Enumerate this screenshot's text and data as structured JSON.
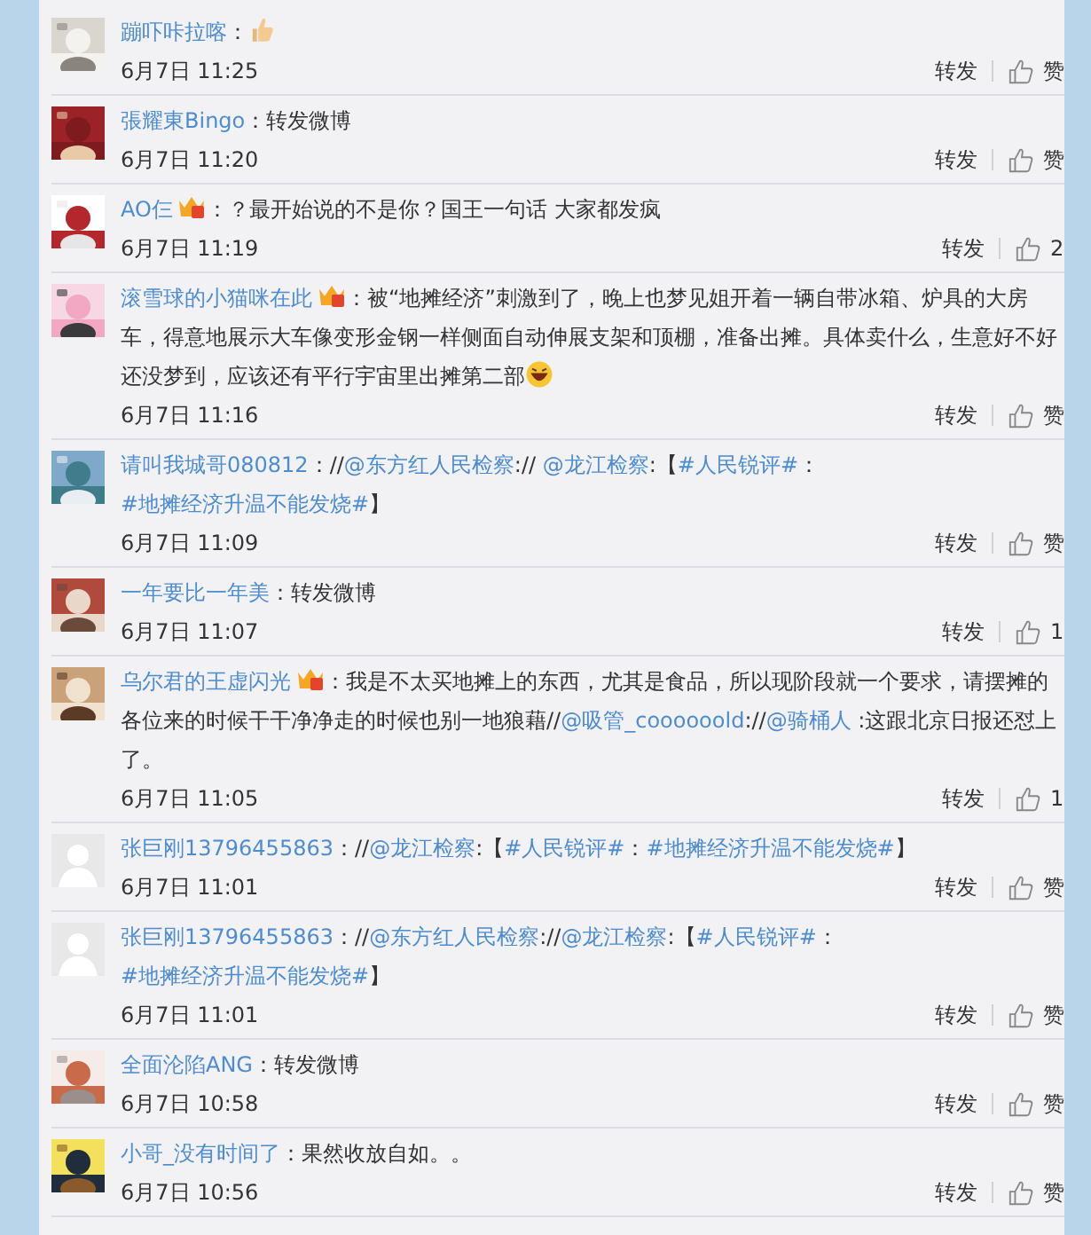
{
  "comments": [
    {
      "user": "蹦吓咔拉喀",
      "avatar": {
        "kind": "picture"
      },
      "badge": false,
      "content": [
        {
          "kind": "text",
          "text": "："
        },
        {
          "kind": "thumb-emoji"
        }
      ],
      "time": "6月7日 11:25",
      "repost": "转发",
      "likes": "赞"
    },
    {
      "user": "張耀東Bingo",
      "avatar": {
        "kind": "picture"
      },
      "badge": false,
      "content": [
        {
          "kind": "text",
          "text": "：转发微博"
        }
      ],
      "time": "6月7日 11:20",
      "repost": "转发",
      "likes": "赞"
    },
    {
      "user": "AO仨",
      "avatar": {
        "kind": "picture"
      },
      "badge": true,
      "content": [
        {
          "kind": "text",
          "text": "：？最开始说的不是你？国王一句话 大家都发疯"
        }
      ],
      "time": "6月7日 11:19",
      "repost": "转发",
      "likes": "2"
    },
    {
      "user": "滚雪球的小猫咪在此",
      "avatar": {
        "kind": "picture"
      },
      "badge": true,
      "content": [
        {
          "kind": "text",
          "text": "：被“地摊经济”刺激到了，晚上也梦见姐开着一辆自带冰箱、炉具的大房车，得意地展示大车像变形金钢一样侧面自动伸展支架和顶棚，准备出摊。具体卖什么，生意好不好还没梦到，应该还有平行宇宙里出摊第二部"
        },
        {
          "kind": "laugh-emoji"
        }
      ],
      "time": "6月7日 11:16",
      "repost": "转发",
      "likes": "赞"
    },
    {
      "user": "请叫我城哥080812",
      "avatar": {
        "kind": "picture"
      },
      "badge": false,
      "content": [
        {
          "kind": "text",
          "text": "：//"
        },
        {
          "kind": "link",
          "text": "@东方红人民检察"
        },
        {
          "kind": "text",
          "text": ":// "
        },
        {
          "kind": "link",
          "text": "@龙江检察"
        },
        {
          "kind": "text",
          "text": ":【"
        },
        {
          "kind": "link",
          "text": "#人民锐评#"
        },
        {
          "kind": "text",
          "text": "："
        },
        {
          "kind": "link",
          "text": "#地摊经济升温不能发烧#"
        },
        {
          "kind": "text",
          "text": "】"
        }
      ],
      "time": "6月7日 11:09",
      "repost": "转发",
      "likes": "赞"
    },
    {
      "user": "一年要比一年美",
      "avatar": {
        "kind": "picture"
      },
      "badge": false,
      "content": [
        {
          "kind": "text",
          "text": "：转发微博"
        }
      ],
      "time": "6月7日 11:07",
      "repost": "转发",
      "likes": "1"
    },
    {
      "user": "乌尔君的王虚闪光",
      "avatar": {
        "kind": "picture"
      },
      "badge": true,
      "content": [
        {
          "kind": "text",
          "text": "：我是不太买地摊上的东西，尤其是食品，所以现阶段就一个要求，请摆摊的各位来的时候干干净净走的时候也别一地狼藉//"
        },
        {
          "kind": "link",
          "text": "@吸管_coooooold"
        },
        {
          "kind": "text",
          "text": "://"
        },
        {
          "kind": "link",
          "text": "@骑桶人"
        },
        {
          "kind": "text",
          "text": " :这跟北京日报还怼上了。"
        }
      ],
      "time": "6月7日 11:05",
      "repost": "转发",
      "likes": "1"
    },
    {
      "user": "张巨刚13796455863",
      "avatar": {
        "kind": "default"
      },
      "badge": false,
      "content": [
        {
          "kind": "text",
          "text": "：//"
        },
        {
          "kind": "link",
          "text": "@龙江检察"
        },
        {
          "kind": "text",
          "text": ":【"
        },
        {
          "kind": "link",
          "text": "#人民锐评#"
        },
        {
          "kind": "text",
          "text": "："
        },
        {
          "kind": "link",
          "text": "#地摊经济升温不能发烧#"
        },
        {
          "kind": "text",
          "text": "】"
        }
      ],
      "time": "6月7日 11:01",
      "repost": "转发",
      "likes": "赞"
    },
    {
      "user": "张巨刚13796455863",
      "avatar": {
        "kind": "default"
      },
      "badge": false,
      "content": [
        {
          "kind": "text",
          "text": "：//"
        },
        {
          "kind": "link",
          "text": "@东方红人民检察"
        },
        {
          "kind": "text",
          "text": "://"
        },
        {
          "kind": "link",
          "text": "@龙江检察"
        },
        {
          "kind": "text",
          "text": ":【"
        },
        {
          "kind": "link",
          "text": "#人民锐评#"
        },
        {
          "kind": "text",
          "text": "："
        },
        {
          "kind": "link",
          "text": "#地摊经济升温不能发烧#"
        },
        {
          "kind": "text",
          "text": "】"
        }
      ],
      "time": "6月7日 11:01",
      "repost": "转发",
      "likes": "赞"
    },
    {
      "user": "全面沦陷ANG",
      "avatar": {
        "kind": "picture"
      },
      "badge": false,
      "content": [
        {
          "kind": "text",
          "text": "：转发微博"
        }
      ],
      "time": "6月7日 10:58",
      "repost": "转发",
      "likes": "赞"
    },
    {
      "user": "小哥_没有时间了",
      "avatar": {
        "kind": "picture"
      },
      "badge": false,
      "content": [
        {
          "kind": "text",
          "text": "：果然收放自如。。"
        }
      ],
      "time": "6月7日 10:56",
      "repost": "转发",
      "likes": "赞"
    }
  ]
}
